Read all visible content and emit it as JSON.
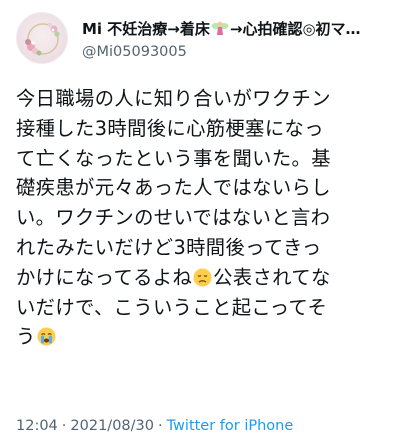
{
  "tweet": {
    "display_name": "Mi 不妊治療→着床",
    "display_name_mid": "→心拍確認◎初マ…",
    "handle": "@Mi05093005",
    "fairy_icon": "fairy-emoji",
    "lines": [
      "今日職場の人に知り合いがワクチン",
      "接種した3時間後に心筋梗塞になっ",
      "て亡くなったという事を聞いた。基",
      "礎疾患が元々あった人ではないらし",
      "い。ワクチンのせいではないと言わ",
      "れたみたいだけど3時間後ってきっ"
    ],
    "line7_a": "かけになってるよね",
    "line7_b": "公表されてな",
    "line8": "いだけで、こういうこと起こってそ",
    "line9": "う",
    "emoji_disappointed": "disappointed-face-emoji",
    "emoji_crying": "crying-face-emoji",
    "time": "12:04",
    "date": "2021/08/30",
    "separator": "·",
    "source": "Twitter for iPhone",
    "colors": {
      "text": "#0f1419",
      "secondary": "#536471",
      "link": "#1d9bf0"
    }
  }
}
